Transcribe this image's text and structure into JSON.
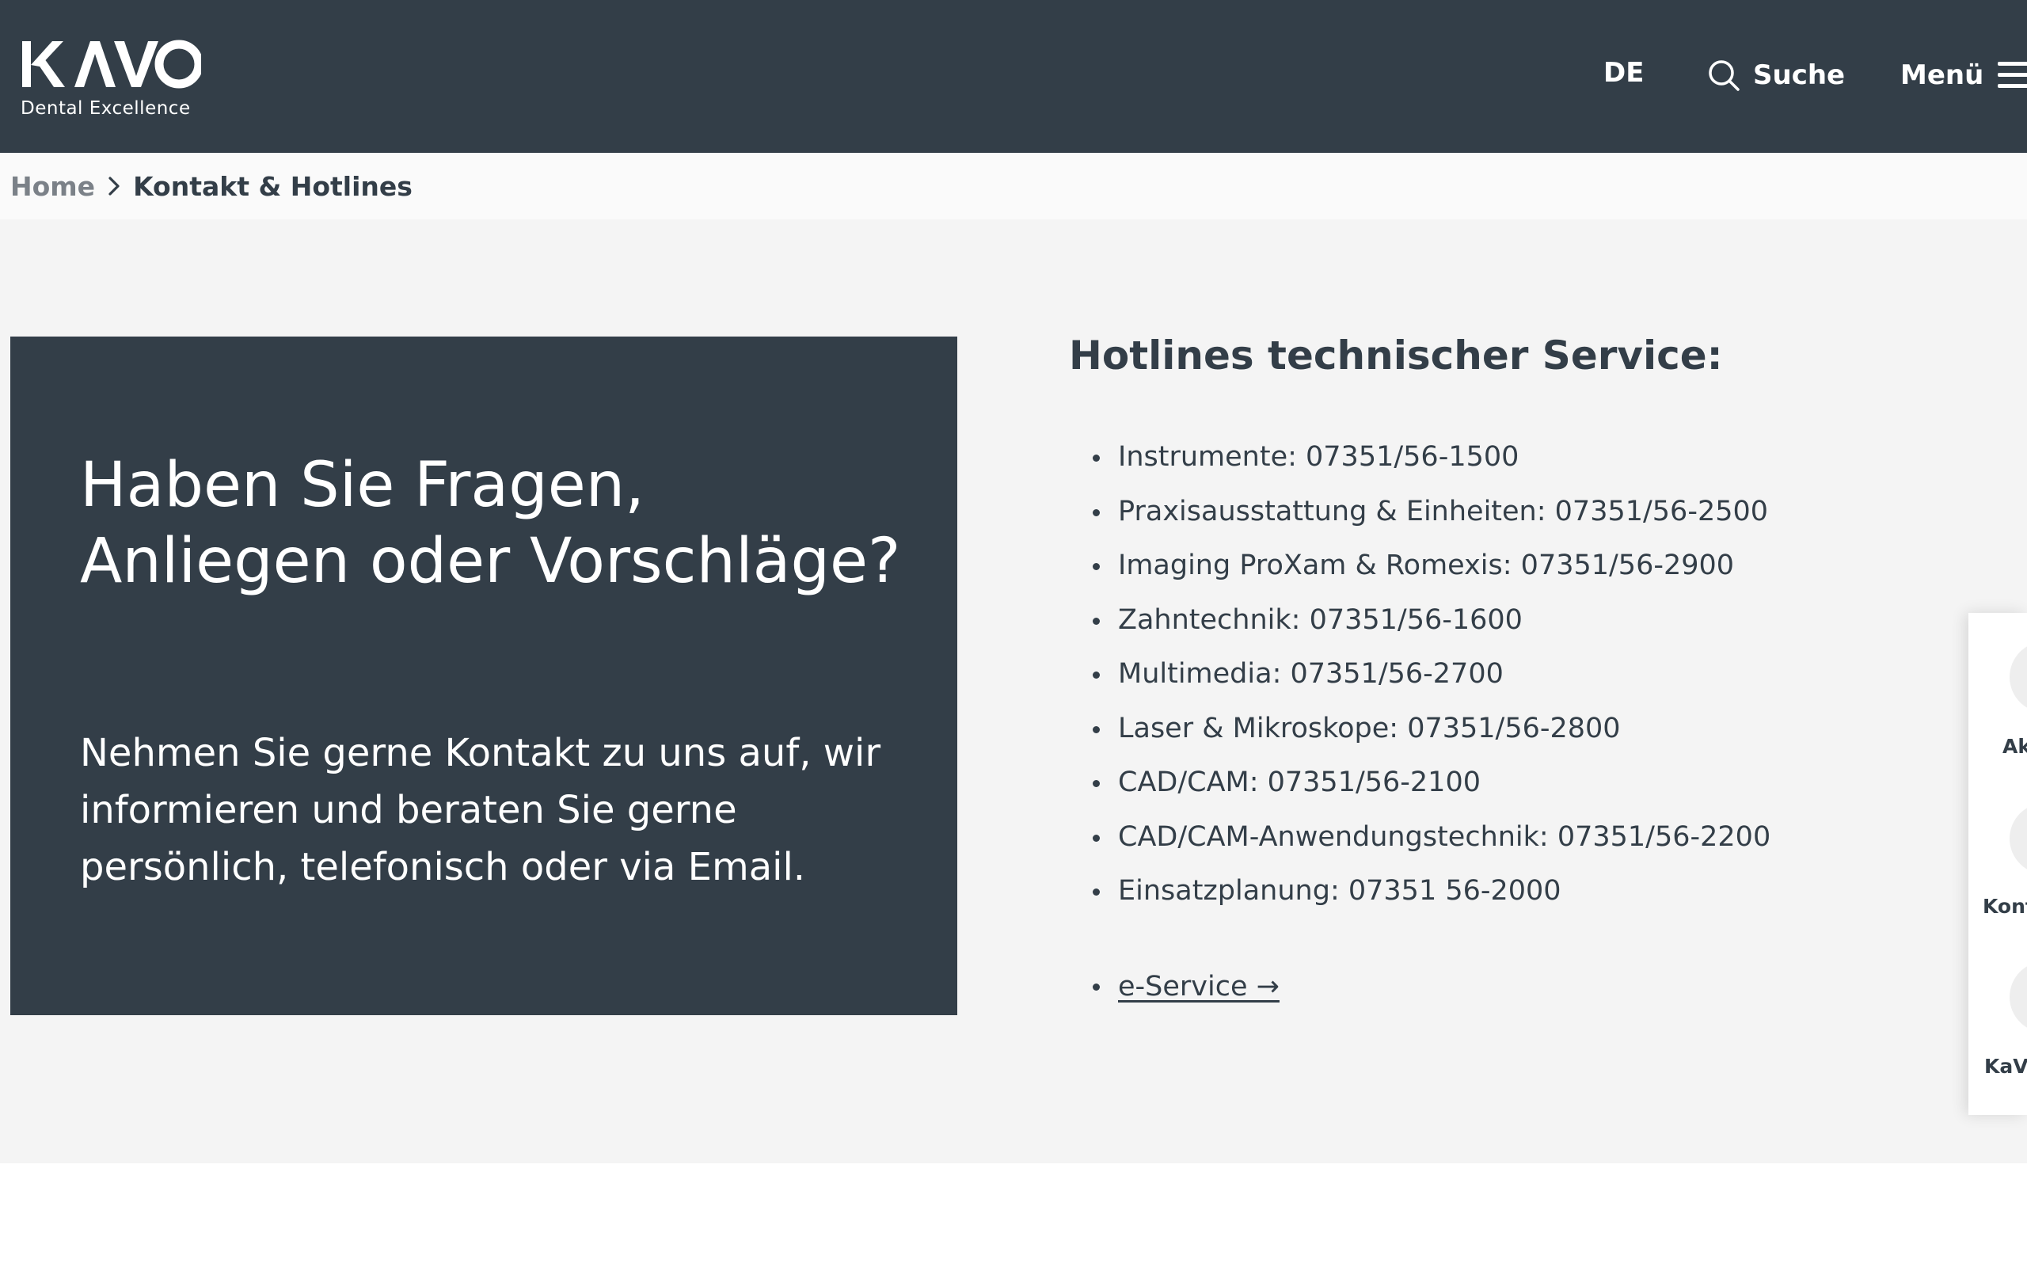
{
  "header": {
    "logo_text": "KAVO",
    "logo_tagline": "Dental Excellence",
    "nav": {
      "language": "DE",
      "search_label": "Suche",
      "menu_label": "Menü"
    }
  },
  "breadcrumb": {
    "home": "Home",
    "current": "Kontakt & Hotlines"
  },
  "hero": {
    "title": "Haben Sie Fragen, Anliegen oder Vorschläge?",
    "text": "Nehmen Sie gerne Kontakt zu uns auf, wir informieren und beraten Sie gerne persönlich, telefonisch oder via Email."
  },
  "hotlines": {
    "title": "Hotlines technischer Service:",
    "items": [
      "Instrumente: 07351/56-1500",
      "Praxisausstattung & Einheiten: 07351/56-2500",
      "Imaging ProXam & Romexis: 07351/56-2900",
      "Zahntechnik: 07351/56-1600",
      "Multimedia: 07351/56-2700",
      "Laser & Mikroskope: 07351/56-2800",
      "CAD/CAM: 07351/56-2100",
      "CAD/CAM-Anwendungstechnik: 07351/56-2200",
      "Einsatzplanung: 07351 56-2000"
    ],
    "eservice_label": "e-Service →"
  },
  "side_panel": {
    "items": [
      {
        "label": "Ak"
      },
      {
        "label": "Kont"
      },
      {
        "label": "KaVo"
      }
    ]
  },
  "colors": {
    "dark": "#333e48",
    "background": "#f4f4f4",
    "breadcrumb_bg": "#fafafa"
  },
  "icons": {
    "search": "search-icon",
    "menu": "hamburger-menu-icon",
    "breadcrumb_separator": "chevron-right-icon"
  }
}
